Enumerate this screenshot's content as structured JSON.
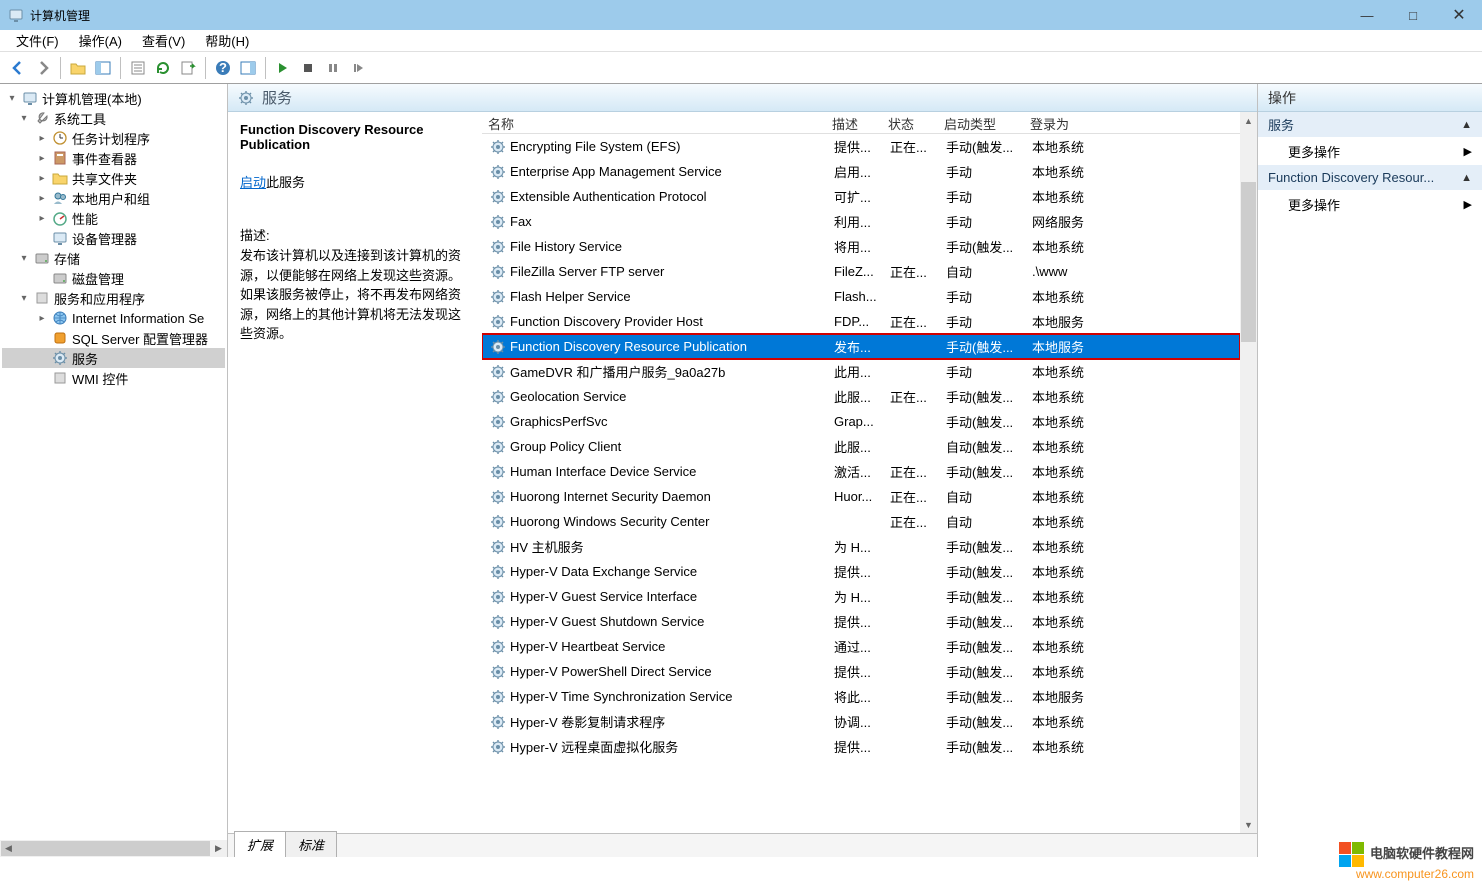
{
  "window": {
    "title": "计算机管理",
    "minimize": "—",
    "maximize": "□",
    "close": "✕"
  },
  "menu": {
    "file": "文件(F)",
    "action": "操作(A)",
    "view": "查看(V)",
    "help": "帮助(H)"
  },
  "tree": {
    "root": "计算机管理(本地)",
    "system_tools": "系统工具",
    "task_scheduler": "任务计划程序",
    "event_viewer": "事件查看器",
    "shared_folders": "共享文件夹",
    "local_users": "本地用户和组",
    "performance": "性能",
    "device_manager": "设备管理器",
    "storage": "存储",
    "disk_management": "磁盘管理",
    "services_apps": "服务和应用程序",
    "iis": "Internet Information Se",
    "sql": "SQL Server 配置管理器",
    "services": "服务",
    "wmi": "WMI 控件"
  },
  "center": {
    "title": "服务",
    "selected_title": "Function Discovery Resource Publication",
    "start_link_prefix": "启动",
    "start_link_suffix": "此服务",
    "desc_label": "描述:",
    "desc_text": "发布该计算机以及连接到该计算机的资源，以便能够在网络上发现这些资源。如果该服务被停止，将不再发布网络资源，网络上的其他计算机将无法发现这些资源。",
    "tabs": {
      "extended": "扩展",
      "standard": "标准"
    }
  },
  "columns": {
    "name": "名称",
    "desc": "描述",
    "state": "状态",
    "startup": "启动类型",
    "logon": "登录为"
  },
  "services": [
    {
      "name": "Encrypting File System (EFS)",
      "desc": "提供...",
      "state": "正在...",
      "startup": "手动(触发...",
      "logon": "本地系统"
    },
    {
      "name": "Enterprise App Management Service",
      "desc": "启用...",
      "state": "",
      "startup": "手动",
      "logon": "本地系统"
    },
    {
      "name": "Extensible Authentication Protocol",
      "desc": "可扩...",
      "state": "",
      "startup": "手动",
      "logon": "本地系统"
    },
    {
      "name": "Fax",
      "desc": "利用...",
      "state": "",
      "startup": "手动",
      "logon": "网络服务"
    },
    {
      "name": "File History Service",
      "desc": "将用...",
      "state": "",
      "startup": "手动(触发...",
      "logon": "本地系统"
    },
    {
      "name": "FileZilla Server FTP server",
      "desc": "FileZ...",
      "state": "正在...",
      "startup": "自动",
      "logon": ".\\www"
    },
    {
      "name": "Flash Helper Service",
      "desc": "Flash...",
      "state": "",
      "startup": "手动",
      "logon": "本地系统"
    },
    {
      "name": "Function Discovery Provider Host",
      "desc": "FDP...",
      "state": "正在...",
      "startup": "手动",
      "logon": "本地服务"
    },
    {
      "name": "Function Discovery Resource Publication",
      "desc": "发布...",
      "state": "",
      "startup": "手动(触发...",
      "logon": "本地服务",
      "selected": true
    },
    {
      "name": "GameDVR 和广播用户服务_9a0a27b",
      "desc": "此用...",
      "state": "",
      "startup": "手动",
      "logon": "本地系统"
    },
    {
      "name": "Geolocation Service",
      "desc": "此服...",
      "state": "正在...",
      "startup": "手动(触发...",
      "logon": "本地系统"
    },
    {
      "name": "GraphicsPerfSvc",
      "desc": "Grap...",
      "state": "",
      "startup": "手动(触发...",
      "logon": "本地系统"
    },
    {
      "name": "Group Policy Client",
      "desc": "此服...",
      "state": "",
      "startup": "自动(触发...",
      "logon": "本地系统"
    },
    {
      "name": "Human Interface Device Service",
      "desc": "激活...",
      "state": "正在...",
      "startup": "手动(触发...",
      "logon": "本地系统"
    },
    {
      "name": "Huorong Internet Security Daemon",
      "desc": "Huor...",
      "state": "正在...",
      "startup": "自动",
      "logon": "本地系统"
    },
    {
      "name": "Huorong Windows Security Center",
      "desc": "",
      "state": "正在...",
      "startup": "自动",
      "logon": "本地系统"
    },
    {
      "name": "HV 主机服务",
      "desc": "为 H...",
      "state": "",
      "startup": "手动(触发...",
      "logon": "本地系统"
    },
    {
      "name": "Hyper-V Data Exchange Service",
      "desc": "提供...",
      "state": "",
      "startup": "手动(触发...",
      "logon": "本地系统"
    },
    {
      "name": "Hyper-V Guest Service Interface",
      "desc": "为 H...",
      "state": "",
      "startup": "手动(触发...",
      "logon": "本地系统"
    },
    {
      "name": "Hyper-V Guest Shutdown Service",
      "desc": "提供...",
      "state": "",
      "startup": "手动(触发...",
      "logon": "本地系统"
    },
    {
      "name": "Hyper-V Heartbeat Service",
      "desc": "通过...",
      "state": "",
      "startup": "手动(触发...",
      "logon": "本地系统"
    },
    {
      "name": "Hyper-V PowerShell Direct Service",
      "desc": "提供...",
      "state": "",
      "startup": "手动(触发...",
      "logon": "本地系统"
    },
    {
      "name": "Hyper-V Time Synchronization Service",
      "desc": "将此...",
      "state": "",
      "startup": "手动(触发...",
      "logon": "本地服务"
    },
    {
      "name": "Hyper-V 卷影复制请求程序",
      "desc": "协调...",
      "state": "",
      "startup": "手动(触发...",
      "logon": "本地系统"
    },
    {
      "name": "Hyper-V 远程桌面虚拟化服务",
      "desc": "提供...",
      "state": "",
      "startup": "手动(触发...",
      "logon": "本地系统"
    }
  ],
  "actions": {
    "title": "操作",
    "section1": "服务",
    "more1": "更多操作",
    "section2": "Function Discovery Resour...",
    "more2": "更多操作"
  },
  "watermark": {
    "line1": "电脑软硬件教程网",
    "line2": "www.computer26.com"
  }
}
